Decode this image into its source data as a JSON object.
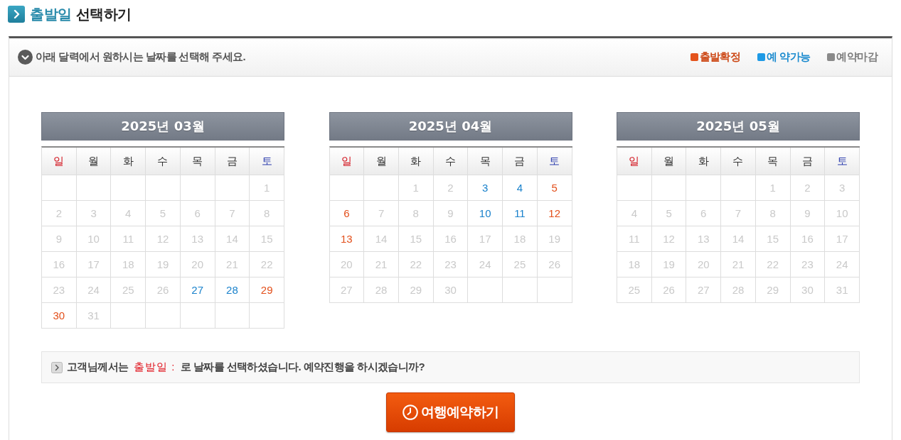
{
  "title": {
    "highlight": "출발일",
    "text": "선택하기"
  },
  "guide": {
    "text": "아래 달력에서 원하시는 날짜를 선택해 주세요.",
    "legend": [
      {
        "label": "출발확정",
        "color": "#e4531c"
      },
      {
        "label": "예 약가능",
        "color": "#1e9ae6"
      },
      {
        "label": "예약마감",
        "color": "#8a8a8a"
      }
    ]
  },
  "calendars": [
    {
      "title": "2025년 03월",
      "weekdays": [
        "일",
        "월",
        "화",
        "수",
        "목",
        "금",
        "토"
      ],
      "weeks": [
        [
          {
            "kind": "blank"
          },
          {
            "kind": "blank"
          },
          {
            "kind": "blank"
          },
          {
            "kind": "blank"
          },
          {
            "kind": "blank"
          },
          {
            "kind": "blank"
          },
          {
            "kind": "closed",
            "day": "1"
          }
        ],
        [
          {
            "kind": "closed",
            "day": "2"
          },
          {
            "kind": "closed",
            "day": "3"
          },
          {
            "kind": "closed",
            "day": "4"
          },
          {
            "kind": "closed",
            "day": "5"
          },
          {
            "kind": "closed",
            "day": "6"
          },
          {
            "kind": "closed",
            "day": "7"
          },
          {
            "kind": "closed",
            "day": "8"
          }
        ],
        [
          {
            "kind": "closed",
            "day": "9"
          },
          {
            "kind": "closed",
            "day": "10"
          },
          {
            "kind": "closed",
            "day": "11"
          },
          {
            "kind": "closed",
            "day": "12"
          },
          {
            "kind": "closed",
            "day": "13"
          },
          {
            "kind": "closed",
            "day": "14"
          },
          {
            "kind": "closed",
            "day": "15"
          }
        ],
        [
          {
            "kind": "closed",
            "day": "16"
          },
          {
            "kind": "closed",
            "day": "17"
          },
          {
            "kind": "closed",
            "day": "18"
          },
          {
            "kind": "closed",
            "day": "19"
          },
          {
            "kind": "closed",
            "day": "20"
          },
          {
            "kind": "closed",
            "day": "21"
          },
          {
            "kind": "closed",
            "day": "22"
          }
        ],
        [
          {
            "kind": "closed",
            "day": "23"
          },
          {
            "kind": "closed",
            "day": "24"
          },
          {
            "kind": "closed",
            "day": "25"
          },
          {
            "kind": "closed",
            "day": "26"
          },
          {
            "kind": "available",
            "day": "27"
          },
          {
            "kind": "available",
            "day": "28"
          },
          {
            "kind": "confirmed",
            "day": "29"
          }
        ],
        [
          {
            "kind": "confirmed",
            "day": "30"
          },
          {
            "kind": "closed",
            "day": "31"
          },
          {
            "kind": "blank"
          },
          {
            "kind": "blank"
          },
          {
            "kind": "blank"
          },
          {
            "kind": "blank"
          },
          {
            "kind": "blank"
          }
        ]
      ]
    },
    {
      "title": "2025년 04월",
      "weekdays": [
        "일",
        "월",
        "화",
        "수",
        "목",
        "금",
        "토"
      ],
      "weeks": [
        [
          {
            "kind": "blank"
          },
          {
            "kind": "blank"
          },
          {
            "kind": "closed",
            "day": "1"
          },
          {
            "kind": "closed",
            "day": "2"
          },
          {
            "kind": "available",
            "day": "3"
          },
          {
            "kind": "available",
            "day": "4"
          },
          {
            "kind": "confirmed",
            "day": "5"
          }
        ],
        [
          {
            "kind": "confirmed",
            "day": "6"
          },
          {
            "kind": "closed",
            "day": "7"
          },
          {
            "kind": "closed",
            "day": "8"
          },
          {
            "kind": "closed",
            "day": "9"
          },
          {
            "kind": "available",
            "day": "10"
          },
          {
            "kind": "available",
            "day": "11"
          },
          {
            "kind": "confirmed",
            "day": "12"
          }
        ],
        [
          {
            "kind": "confirmed",
            "day": "13"
          },
          {
            "kind": "closed",
            "day": "14"
          },
          {
            "kind": "closed",
            "day": "15"
          },
          {
            "kind": "closed",
            "day": "16"
          },
          {
            "kind": "closed",
            "day": "17"
          },
          {
            "kind": "closed",
            "day": "18"
          },
          {
            "kind": "closed",
            "day": "19"
          }
        ],
        [
          {
            "kind": "closed",
            "day": "20"
          },
          {
            "kind": "closed",
            "day": "21"
          },
          {
            "kind": "closed",
            "day": "22"
          },
          {
            "kind": "closed",
            "day": "23"
          },
          {
            "kind": "closed",
            "day": "24"
          },
          {
            "kind": "closed",
            "day": "25"
          },
          {
            "kind": "closed",
            "day": "26"
          }
        ],
        [
          {
            "kind": "closed",
            "day": "27"
          },
          {
            "kind": "closed",
            "day": "28"
          },
          {
            "kind": "closed",
            "day": "29"
          },
          {
            "kind": "closed",
            "day": "30"
          },
          {
            "kind": "blank"
          },
          {
            "kind": "blank"
          },
          {
            "kind": "blank"
          }
        ]
      ]
    },
    {
      "title": "2025년 05월",
      "weekdays": [
        "일",
        "월",
        "화",
        "수",
        "목",
        "금",
        "토"
      ],
      "weeks": [
        [
          {
            "kind": "blank"
          },
          {
            "kind": "blank"
          },
          {
            "kind": "blank"
          },
          {
            "kind": "blank"
          },
          {
            "kind": "closed",
            "day": "1"
          },
          {
            "kind": "closed",
            "day": "2"
          },
          {
            "kind": "closed",
            "day": "3"
          }
        ],
        [
          {
            "kind": "closed",
            "day": "4"
          },
          {
            "kind": "closed",
            "day": "5"
          },
          {
            "kind": "closed",
            "day": "6"
          },
          {
            "kind": "closed",
            "day": "7"
          },
          {
            "kind": "closed",
            "day": "8"
          },
          {
            "kind": "closed",
            "day": "9"
          },
          {
            "kind": "closed",
            "day": "10"
          }
        ],
        [
          {
            "kind": "closed",
            "day": "11"
          },
          {
            "kind": "closed",
            "day": "12"
          },
          {
            "kind": "closed",
            "day": "13"
          },
          {
            "kind": "closed",
            "day": "14"
          },
          {
            "kind": "closed",
            "day": "15"
          },
          {
            "kind": "closed",
            "day": "16"
          },
          {
            "kind": "closed",
            "day": "17"
          }
        ],
        [
          {
            "kind": "closed",
            "day": "18"
          },
          {
            "kind": "closed",
            "day": "19"
          },
          {
            "kind": "closed",
            "day": "20"
          },
          {
            "kind": "closed",
            "day": "21"
          },
          {
            "kind": "closed",
            "day": "22"
          },
          {
            "kind": "closed",
            "day": "23"
          },
          {
            "kind": "closed",
            "day": "24"
          }
        ],
        [
          {
            "kind": "closed",
            "day": "25"
          },
          {
            "kind": "closed",
            "day": "26"
          },
          {
            "kind": "closed",
            "day": "27"
          },
          {
            "kind": "closed",
            "day": "28"
          },
          {
            "kind": "closed",
            "day": "29"
          },
          {
            "kind": "closed",
            "day": "30"
          },
          {
            "kind": "closed",
            "day": "31"
          }
        ]
      ]
    }
  ],
  "confirmation": {
    "before": "고객님께서는",
    "date": "출발일 :",
    "after": "로 날짜를 선택하셨습니다. 예약진행을 하시겠습니까?"
  },
  "reserve_button": {
    "label": "여행예약하기"
  }
}
